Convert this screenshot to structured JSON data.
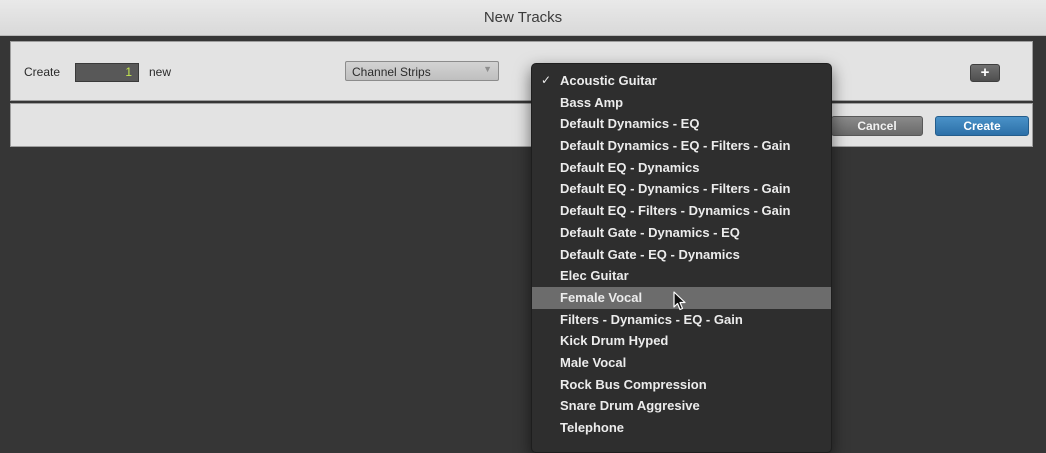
{
  "window": {
    "title": "New Tracks"
  },
  "create_row": {
    "create_label": "Create",
    "count_value": "1",
    "new_label": "new",
    "track_type_selected": "Channel Strips",
    "add_row_label": "+"
  },
  "footer": {
    "cancel_label": "Cancel",
    "create_label": "Create"
  },
  "preset_menu": {
    "items": [
      {
        "label": "Acoustic Guitar",
        "checked": true
      },
      {
        "label": "Bass Amp"
      },
      {
        "label": "Default Dynamics - EQ"
      },
      {
        "label": "Default Dynamics - EQ - Filters - Gain"
      },
      {
        "label": "Default EQ - Dynamics"
      },
      {
        "label": "Default EQ - Dynamics - Filters - Gain"
      },
      {
        "label": "Default EQ - Filters - Dynamics - Gain"
      },
      {
        "label": "Default Gate - Dynamics - EQ"
      },
      {
        "label": "Default Gate - EQ - Dynamics"
      },
      {
        "label": "Elec Guitar"
      },
      {
        "label": "Female Vocal",
        "hovered": true
      },
      {
        "label": "Filters - Dynamics - EQ - Gain"
      },
      {
        "label": "Kick Drum Hyped"
      },
      {
        "label": "Male Vocal"
      },
      {
        "label": "Rock Bus Compression"
      },
      {
        "label": "Snare Drum Aggresive"
      },
      {
        "label": "Telephone"
      }
    ]
  },
  "colors": {
    "background": "#363636",
    "menu_background": "#2e2e2e",
    "menu_highlight": "#6c6c6c",
    "create_button": "#2c6fa8",
    "count_text": "#c5e850"
  }
}
